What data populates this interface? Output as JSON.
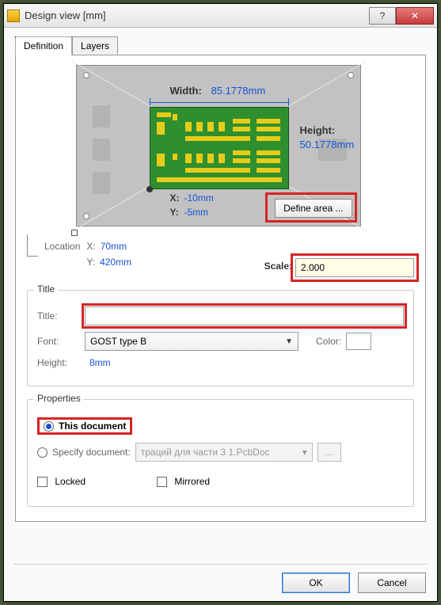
{
  "window": {
    "title": "Design view [mm]"
  },
  "tabs": {
    "definition": "Definition",
    "layers": "Layers"
  },
  "preview": {
    "width_label": "Width:",
    "width_value": "85.1778mm",
    "height_label": "Height:",
    "height_value": "50.1778mm",
    "x_label": "X:",
    "x_value": "-10mm",
    "y_label": "Y:",
    "y_value": "-5mm",
    "define_button": "Define area ..."
  },
  "location": {
    "label": "Location",
    "x_label": "X:",
    "x_value": "70mm",
    "y_label": "Y:",
    "y_value": "420mm"
  },
  "scale": {
    "label": "Scale:",
    "value": "2.000"
  },
  "title_group": {
    "legend": "Title",
    "title_label": "Title:",
    "title_value": "",
    "font_label": "Font:",
    "font_value": "GOST type B",
    "color_label": "Color:",
    "height_label": "Height:",
    "height_value": "8mm"
  },
  "properties": {
    "legend": "Properties",
    "this_document": "This document",
    "specify_document": "Specify document:",
    "specify_value": "траций для части 3 1.PcbDoc",
    "browse": "...",
    "locked": "Locked",
    "mirrored": "Mirrored"
  },
  "buttons": {
    "ok": "OK",
    "cancel": "Cancel"
  }
}
